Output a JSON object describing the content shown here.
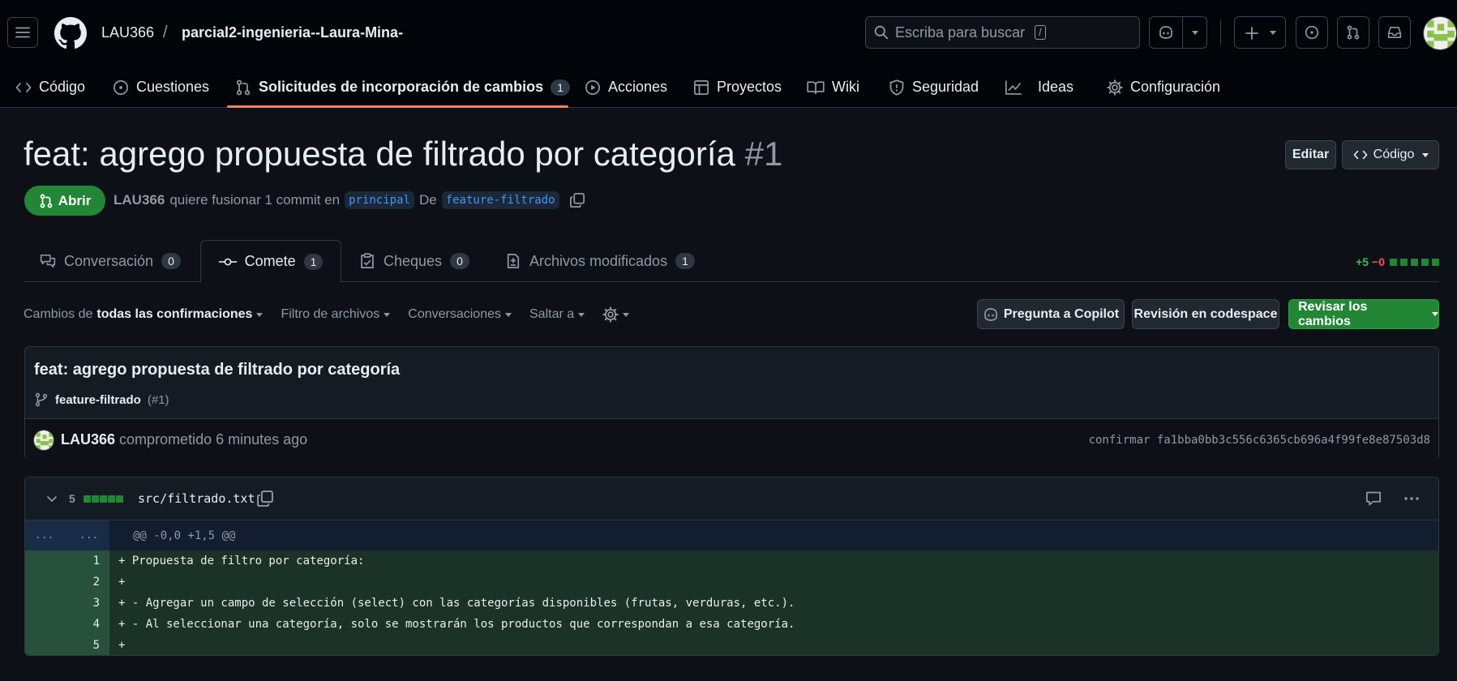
{
  "header": {
    "owner": "LAU366",
    "separator": "/",
    "repo": "parcial2-ingenieria--Laura-Mina-",
    "search_placeholder": "Escriba para buscar",
    "search_shortcut": "/"
  },
  "repo_nav": {
    "items": [
      {
        "label": "Código"
      },
      {
        "label": "Cuestiones"
      },
      {
        "label": "Solicitudes de incorporación de cambios",
        "count": "1",
        "active": true
      },
      {
        "label": "Acciones"
      },
      {
        "label": "Proyectos"
      },
      {
        "label": "Wiki"
      },
      {
        "label": "Seguridad"
      },
      {
        "label": "Ideas"
      },
      {
        "label": "Configuración"
      }
    ]
  },
  "pr": {
    "title": "feat: agrego propuesta de filtrado por categoría",
    "number": "#1",
    "edit_label": "Editar",
    "code_label": "Código",
    "state": "Abrir",
    "author": "LAU366",
    "merge_text": "quiere fusionar 1 commit en",
    "base_branch": "principal",
    "from_text": "De",
    "head_branch": "feature-filtrado"
  },
  "tabs": [
    {
      "label": "Conversación",
      "count": "0"
    },
    {
      "label": "Comete",
      "count": "1",
      "active": true
    },
    {
      "label": "Cheques",
      "count": "0"
    },
    {
      "label": "Archivos modificados",
      "count": "1"
    }
  ],
  "diffstat": {
    "additions": "+5",
    "deletions": "−0"
  },
  "toolbar": {
    "changes_prefix": "Cambios de",
    "changes_value": "todas las confirmaciones",
    "file_filter": "Filtro de archivos",
    "conversations": "Conversaciones",
    "jump_to": "Saltar a",
    "ask_copilot": "Pregunta a Copilot",
    "codespace_review": "Revisión en codespace",
    "review_changes": "Revisar los cambios"
  },
  "commit": {
    "title": "feat: agrego propuesta de filtrado por categoría",
    "branch": "feature-filtrado",
    "pr_ref": "(#1)",
    "author": "LAU366",
    "action": "comprometido",
    "time": "6 minutes ago",
    "sha_label": "confirmar fa1bba0bb3c556c6365cb696a4f99fe8e87503d8"
  },
  "file": {
    "changes": "5",
    "path": "src/filtrado.txt",
    "hunk_left": "...",
    "hunk_right": "...",
    "hunk_header": "@@ -0,0 +1,5 @@",
    "lines": [
      {
        "num": "1",
        "text": "+ Propuesta de filtro por categoría:"
      },
      {
        "num": "2",
        "text": "+"
      },
      {
        "num": "3",
        "text": "+ - Agregar un campo de selección (select) con las categorías disponibles (frutas, verduras, etc.)."
      },
      {
        "num": "4",
        "text": "+ - Al seleccionar una categoría, solo se mostrarán los productos que correspondan a esa categoría."
      },
      {
        "num": "5",
        "text": "+"
      }
    ]
  },
  "colors": {
    "accent_green": "#238636",
    "underline_orange": "#f78166",
    "link_blue": "#4493f8"
  }
}
